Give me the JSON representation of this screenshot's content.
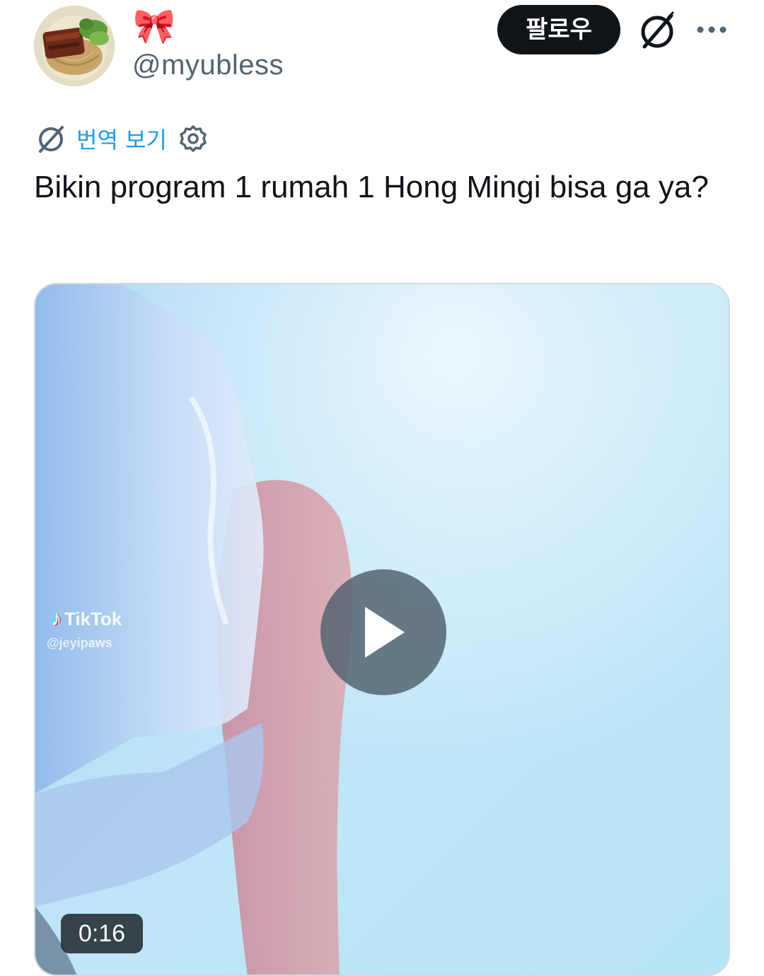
{
  "author": {
    "display_name": "🎀",
    "handle": "@myubless",
    "avatar_icon": "food-dish-avatar"
  },
  "actions": {
    "follow_label": "팔로우",
    "grok_icon": "grok-icon",
    "more_icon": "more-icon"
  },
  "translate": {
    "label": "번역 보기",
    "icon": "translate-grok-icon",
    "settings_icon": "settings-gear-icon",
    "accent_color": "#1d9bf0"
  },
  "tweet": {
    "text": "Bikin program 1 rumah 1 Hong Mingi bisa ga ya?"
  },
  "media": {
    "watermark_brand": "TikTok",
    "watermark_user": "@jeyipaws",
    "duration": "0:16",
    "play_icon": "play-icon"
  },
  "colors": {
    "text": "#0f1419",
    "secondary_text": "#536471",
    "follow_button_bg": "#0f1419",
    "link_blue": "#1d9bf0"
  }
}
